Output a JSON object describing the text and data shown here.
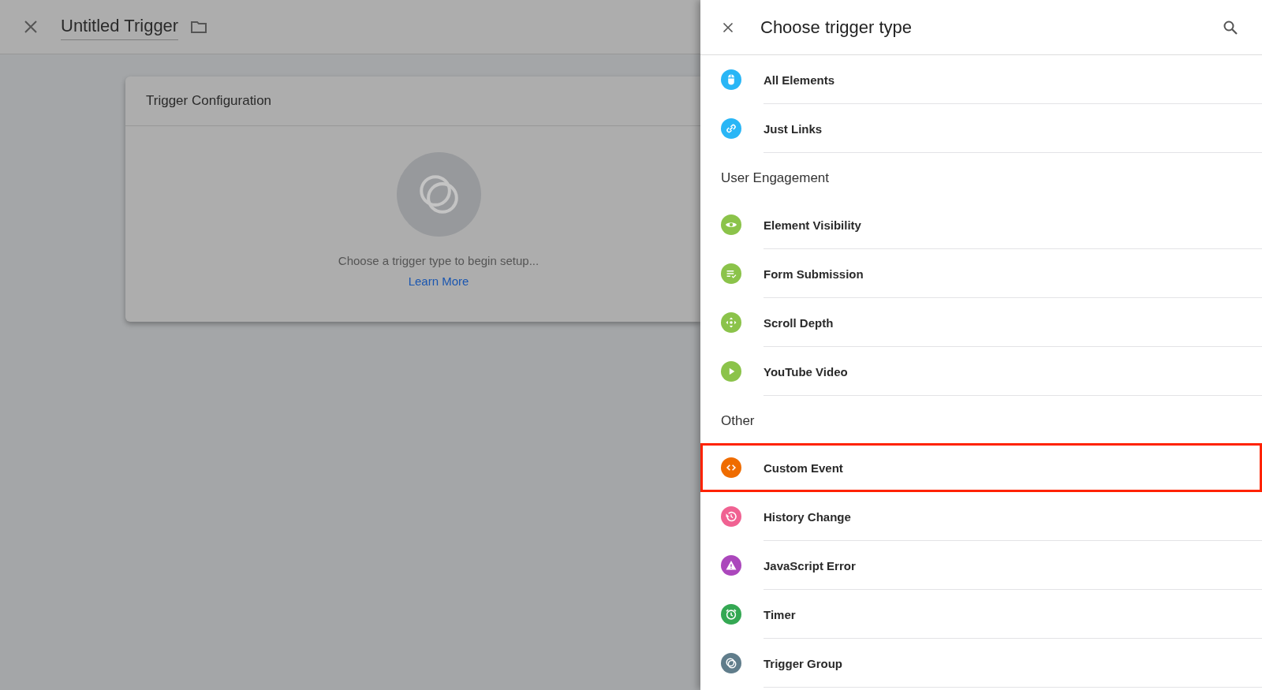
{
  "editor": {
    "title": "Untitled Trigger",
    "card": {
      "title": "Trigger Configuration",
      "message": "Choose a trigger type to begin setup...",
      "link": "Learn More"
    }
  },
  "panel": {
    "title": "Choose trigger type",
    "sections": [
      {
        "items": [
          {
            "label": "All Elements",
            "kind": "mouse",
            "color": "#29b6f6",
            "highlighted": false
          },
          {
            "label": "Just Links",
            "kind": "link",
            "color": "#29b6f6",
            "highlighted": false
          }
        ]
      },
      {
        "heading": "User Engagement",
        "items": [
          {
            "label": "Element Visibility",
            "kind": "eye",
            "color": "#8bc34a",
            "highlighted": false
          },
          {
            "label": "Form Submission",
            "kind": "form",
            "color": "#8bc34a",
            "highlighted": false
          },
          {
            "label": "Scroll Depth",
            "kind": "scroll",
            "color": "#8bc34a",
            "highlighted": false
          },
          {
            "label": "YouTube Video",
            "kind": "play",
            "color": "#8bc34a",
            "highlighted": false
          }
        ]
      },
      {
        "heading": "Other",
        "items": [
          {
            "label": "Custom Event",
            "kind": "code",
            "color": "#ef6c00",
            "highlighted": true
          },
          {
            "label": "History Change",
            "kind": "history",
            "color": "#f06292",
            "highlighted": false
          },
          {
            "label": "JavaScript Error",
            "kind": "warning",
            "color": "#ab47bc",
            "highlighted": false
          },
          {
            "label": "Timer",
            "kind": "timer",
            "color": "#34a853",
            "highlighted": false
          },
          {
            "label": "Trigger Group",
            "kind": "group",
            "color": "#607d8b",
            "highlighted": false
          }
        ]
      }
    ]
  }
}
